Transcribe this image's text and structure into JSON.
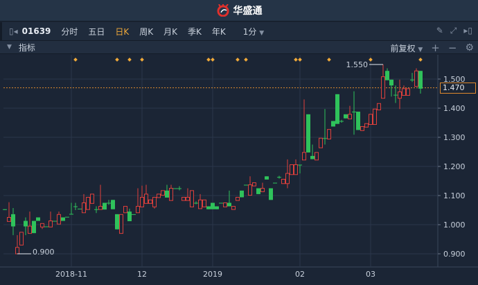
{
  "app": {
    "title": "华盛通"
  },
  "toolbar": {
    "code": "01639",
    "tabs": [
      "分时",
      "五日",
      "日K",
      "周K",
      "月K",
      "季K",
      "年K"
    ],
    "active_tab": "日K",
    "interval": "1分"
  },
  "indicator_bar": {
    "label": "指标",
    "adjust": "前复权"
  },
  "colors": {
    "up": "#e0403c",
    "down": "#2fc25b",
    "marker": "#f0a93a",
    "grid": "#2b374a",
    "bg": "#1b2535"
  },
  "chart_data": {
    "type": "candlestick",
    "ylim": [
      0.86,
      1.6
    ],
    "y_ticks": [
      "1.500",
      "1.400",
      "1.300",
      "1.200",
      "1.100",
      "1.000",
      "0.900"
    ],
    "y_tick_values": [
      1.5,
      1.4,
      1.3,
      1.2,
      1.1,
      1.0,
      0.9
    ],
    "x_labels": [
      {
        "label": "2018-11",
        "index": 16
      },
      {
        "label": "12",
        "index": 33
      },
      {
        "label": "2019",
        "index": 50
      },
      {
        "label": "02",
        "index": 71
      },
      {
        "label": "03",
        "index": 88
      }
    ],
    "current_price": "1.470",
    "current_value": 1.47,
    "max_label": {
      "text": "1.550",
      "index": 91,
      "value": 1.55
    },
    "min_label": {
      "text": "0.900",
      "index": 3,
      "value": 0.9
    },
    "markers": [
      17,
      27,
      30,
      33,
      49,
      50,
      56,
      58,
      70,
      71,
      78,
      88,
      100
    ],
    "ohlc": [
      [
        1.053,
        1.053,
        1.05,
        1.053
      ],
      [
        1.011,
        1.077,
        1.011,
        1.025
      ],
      [
        1.036,
        1.057,
        0.964,
        0.994
      ],
      [
        0.9,
        0.964,
        0.9,
        0.922
      ],
      [
        0.93,
        0.974,
        0.93,
        0.974
      ],
      [
        1.013,
        1.025,
        0.964,
        0.994
      ],
      [
        0.97,
        1.045,
        0.97,
        0.995
      ],
      [
        1.013,
        1.013,
        0.971,
        0.971
      ],
      [
        1.025,
        1.025,
        1.013,
        1.013
      ],
      [
        0.992,
        1.004,
        0.985,
        1.004
      ],
      [
        0.994,
        0.994,
        0.994,
        0.994
      ],
      [
        0.992,
        1.045,
        0.992,
        1.013
      ],
      [
        1.013,
        1.013,
        1.013,
        1.013
      ],
      [
        1.002,
        1.045,
        1.002,
        1.035
      ],
      [
        1.025,
        1.025,
        1.013,
        1.013
      ],
      [
        1.027,
        1.027,
        1.027,
        1.027
      ],
      [
        1.037,
        1.075,
        1.037,
        1.037
      ],
      [
        1.063,
        1.075,
        1.05,
        1.063
      ],
      [
        1.055,
        1.055,
        1.055,
        1.055
      ],
      [
        1.041,
        1.105,
        1.041,
        1.075
      ],
      [
        1.052,
        1.094,
        1.052,
        1.094
      ],
      [
        1.073,
        1.105,
        1.073,
        1.105
      ],
      [
        1.053,
        1.063,
        1.04,
        1.053
      ],
      [
        1.052,
        1.137,
        1.052,
        1.063
      ],
      [
        1.075,
        1.075,
        1.052,
        1.052
      ],
      [
        1.075,
        1.085,
        1.068,
        1.075
      ],
      [
        1.085,
        1.085,
        1.053,
        1.053
      ],
      [
        1.036,
        1.036,
        0.984,
        0.984
      ],
      [
        0.97,
        1.035,
        0.97,
        1.035
      ],
      [
        1.041,
        1.063,
        1.041,
        1.063
      ],
      [
        1.045,
        1.055,
        1.012,
        1.012
      ],
      [
        1.036,
        1.036,
        1.036,
        1.036
      ],
      [
        1.041,
        1.125,
        1.041,
        1.063
      ],
      [
        1.061,
        1.134,
        1.061,
        1.094
      ],
      [
        1.073,
        1.137,
        1.073,
        1.105
      ],
      [
        1.073,
        1.085,
        1.073,
        1.085
      ],
      [
        1.061,
        1.094,
        1.055,
        1.094
      ],
      [
        1.093,
        1.105,
        1.093,
        1.105
      ],
      [
        1.101,
        1.117,
        1.101,
        1.117
      ],
      [
        1.117,
        1.137,
        1.093,
        1.093
      ],
      [
        1.083,
        1.137,
        1.083,
        1.125
      ],
      [
        1.125,
        1.125,
        1.125,
        1.125
      ],
      [
        1.125,
        1.132,
        1.118,
        1.125
      ],
      [
        1.083,
        1.094,
        1.083,
        1.094
      ],
      [
        1.083,
        1.125,
        1.083,
        1.094
      ],
      [
        1.061,
        1.117,
        1.061,
        1.117
      ],
      [
        1.075,
        1.08,
        1.07,
        1.075
      ],
      [
        1.055,
        1.105,
        1.055,
        1.085
      ],
      [
        1.061,
        1.085,
        1.061,
        1.085
      ],
      [
        1.063,
        1.063,
        1.053,
        1.053
      ],
      [
        1.075,
        1.075,
        1.053,
        1.053
      ],
      [
        1.063,
        1.063,
        1.053,
        1.053
      ],
      [
        1.075,
        1.075,
        1.075,
        1.075
      ],
      [
        1.061,
        1.075,
        1.061,
        1.075
      ],
      [
        1.075,
        1.117,
        1.063,
        1.063
      ],
      [
        1.052,
        1.063,
        1.052,
        1.063
      ],
      [
        1.083,
        1.094,
        1.083,
        1.094
      ],
      [
        1.117,
        1.117,
        1.094,
        1.094
      ],
      [
        1.137,
        1.137,
        1.137,
        1.137
      ],
      [
        1.101,
        1.166,
        1.101,
        1.137
      ],
      [
        1.133,
        1.144,
        1.133,
        1.144
      ],
      [
        1.125,
        1.125,
        1.105,
        1.105
      ],
      [
        1.113,
        1.144,
        1.113,
        1.125
      ],
      [
        1.166,
        1.166,
        1.155,
        1.155
      ],
      [
        1.125,
        1.125,
        1.085,
        1.085
      ],
      [
        1.144,
        1.144,
        1.144,
        1.144
      ],
      [
        1.164,
        1.168,
        1.158,
        1.164
      ],
      [
        1.141,
        1.156,
        1.141,
        1.156
      ],
      [
        1.141,
        1.224,
        1.125,
        1.176
      ],
      [
        1.172,
        1.206,
        1.172,
        1.206
      ],
      [
        1.172,
        1.224,
        1.172,
        1.206
      ],
      [
        1.206,
        1.206,
        1.176,
        1.206
      ],
      [
        1.222,
        1.43,
        1.222,
        1.248
      ],
      [
        1.379,
        1.379,
        1.248,
        1.248
      ],
      [
        1.236,
        1.275,
        1.225,
        1.225
      ],
      [
        1.222,
        1.248,
        1.222,
        1.248
      ],
      [
        1.264,
        1.297,
        1.264,
        1.297
      ],
      [
        1.297,
        1.397,
        1.275,
        1.297
      ],
      [
        1.294,
        1.327,
        1.294,
        1.327
      ],
      [
        1.356,
        1.356,
        1.337,
        1.337
      ],
      [
        1.448,
        1.448,
        1.346,
        1.346
      ],
      [
        1.356,
        1.36,
        1.35,
        1.356
      ],
      [
        1.379,
        1.379,
        1.365,
        1.365
      ],
      [
        1.363,
        1.408,
        1.363,
        1.379
      ],
      [
        1.388,
        1.458,
        1.309,
        1.388
      ],
      [
        1.388,
        1.388,
        1.325,
        1.325
      ],
      [
        1.323,
        1.337,
        1.323,
        1.337
      ],
      [
        1.335,
        1.347,
        1.335,
        1.347
      ],
      [
        1.344,
        1.379,
        1.344,
        1.379
      ],
      [
        1.344,
        1.397,
        1.344,
        1.397
      ],
      [
        1.394,
        1.416,
        1.394,
        1.416
      ],
      [
        1.434,
        1.55,
        1.434,
        1.508
      ],
      [
        1.528,
        1.537,
        1.496,
        1.496
      ],
      [
        1.498,
        1.498,
        1.44,
        1.478
      ],
      [
        1.446,
        1.478,
        1.418,
        1.446
      ],
      [
        1.434,
        1.498,
        1.397,
        1.456
      ],
      [
        1.444,
        1.478,
        1.444,
        1.467
      ],
      [
        1.444,
        1.467,
        1.444,
        1.467
      ],
      [
        1.498,
        1.521,
        1.49,
        1.498
      ],
      [
        1.475,
        1.537,
        1.475,
        1.528
      ],
      [
        1.528,
        1.528,
        1.45,
        1.467
      ]
    ]
  }
}
